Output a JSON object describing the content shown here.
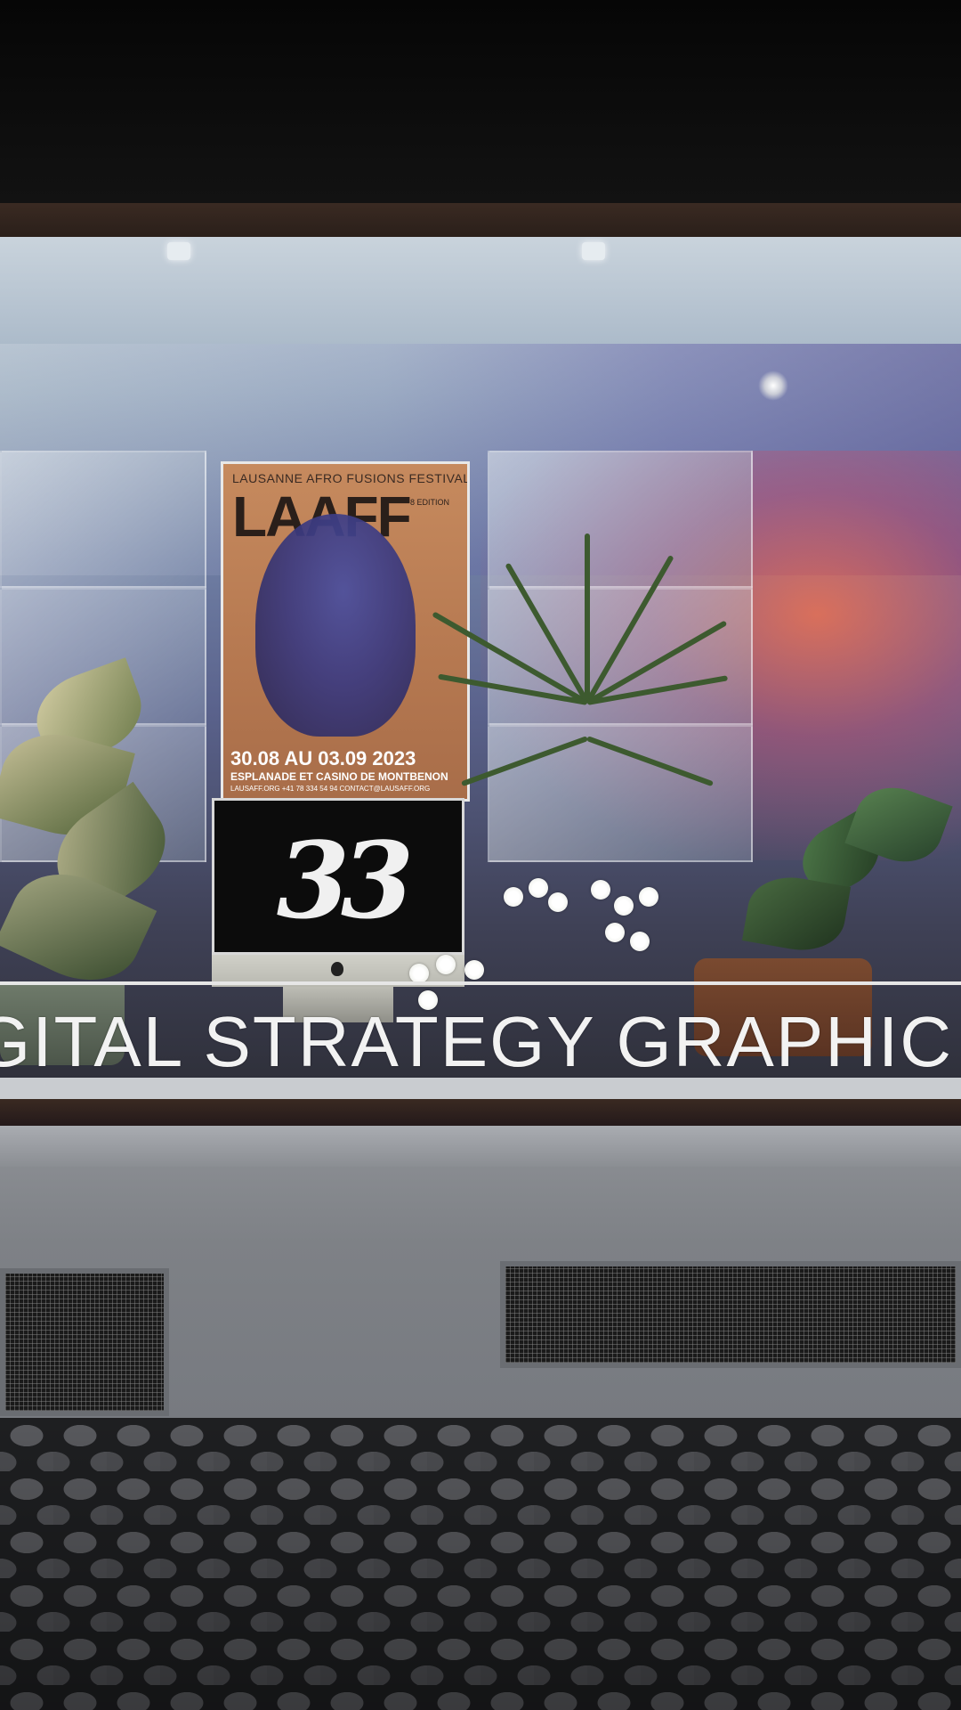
{
  "decal": {
    "text": "GITAL STRATEGY GRAPHIC D",
    "color": "#f2f2f2"
  },
  "poster": {
    "festival_name": "LAUSANNE AFRO FUSIONS FESTIVAL",
    "logo_text": "LAAFF",
    "edition": "8 EDITION",
    "dates": "30.08 AU 03.09 2023",
    "venue": "ESPLANADE ET CASINO DE MONTBENON",
    "contact": "LAUSAFF.ORG    +41 78 334 54 94   CONTACT@LAUSAFF.ORG",
    "background_color": "#b57850"
  },
  "screen": {
    "logo_text": "33"
  },
  "colors": {
    "frame": "#3a2a22",
    "wall": "#8e9196",
    "night_sky": "#0b0b0c"
  }
}
